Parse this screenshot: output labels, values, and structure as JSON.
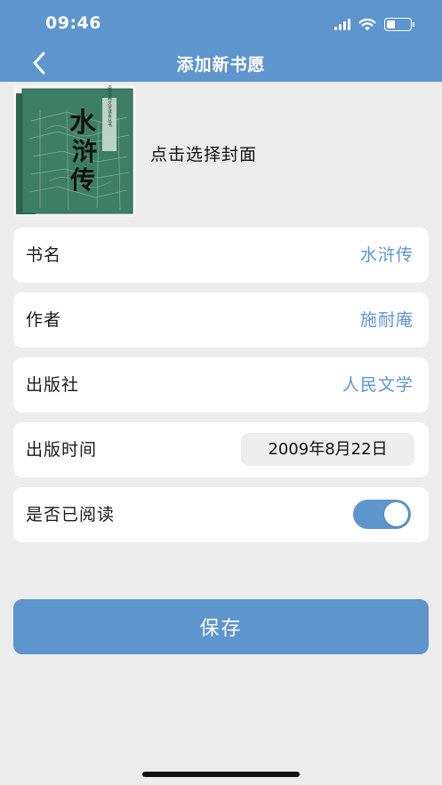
{
  "status_bar": {
    "time": "09:46",
    "battery_level": 0.35
  },
  "nav": {
    "back_icon": "chevron-left-icon",
    "title": "添加新书愿"
  },
  "cover": {
    "book_title_art": "水浒传",
    "series_art": "中国古典文学读本丛书",
    "hint": "点击选择封面",
    "colors": {
      "cover_bg": "#3e7d66",
      "cover_dark": "#2f6452"
    }
  },
  "fields": {
    "title": {
      "label": "书名",
      "value": "水浒传"
    },
    "author": {
      "label": "作者",
      "value": "施耐庵"
    },
    "publisher": {
      "label": "出版社",
      "value": "人民文学"
    },
    "publish_date": {
      "label": "出版时间",
      "value": "2009年8月22日"
    },
    "read": {
      "label": "是否已阅读",
      "checked": true
    }
  },
  "save_button": {
    "label": "保存"
  },
  "colors": {
    "accent": "#5d95cc",
    "background": "#ececec",
    "card": "#ffffff"
  }
}
